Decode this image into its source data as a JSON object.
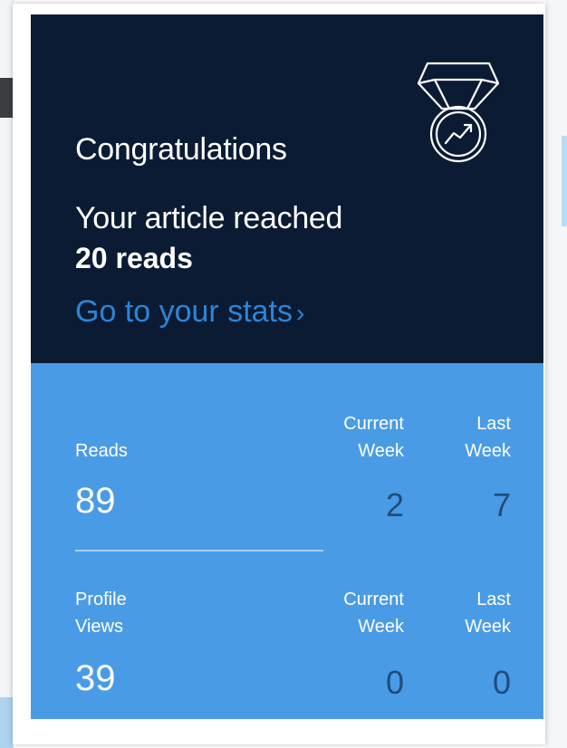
{
  "banner": {
    "heading": "Congratulations",
    "message": "Your article reached",
    "reads_count": "20 reads",
    "stats_link": "Go to your stats",
    "stats_chevron": "›",
    "icon": "medal-trending-icon"
  },
  "stats": {
    "reads": {
      "label": "Reads",
      "total": "89",
      "current_week_label_1": "Current",
      "current_week_label_2": "Week",
      "last_week_label_1": "Last",
      "last_week_label_2": "Week",
      "current_week": "2",
      "last_week": "7"
    },
    "profile_views": {
      "label_1": "Profile",
      "label_2": "Views",
      "total": "39",
      "current_week_label_1": "Current",
      "current_week_label_2": "Week",
      "last_week_label_1": "Last",
      "last_week_label_2": "Week",
      "current_week": "0",
      "last_week": "0"
    }
  },
  "colors": {
    "banner_bg": "#0b1b33",
    "link": "#2d84d8",
    "stats_bg": "#4a9be6",
    "stat_value": "#1f4e7a"
  }
}
